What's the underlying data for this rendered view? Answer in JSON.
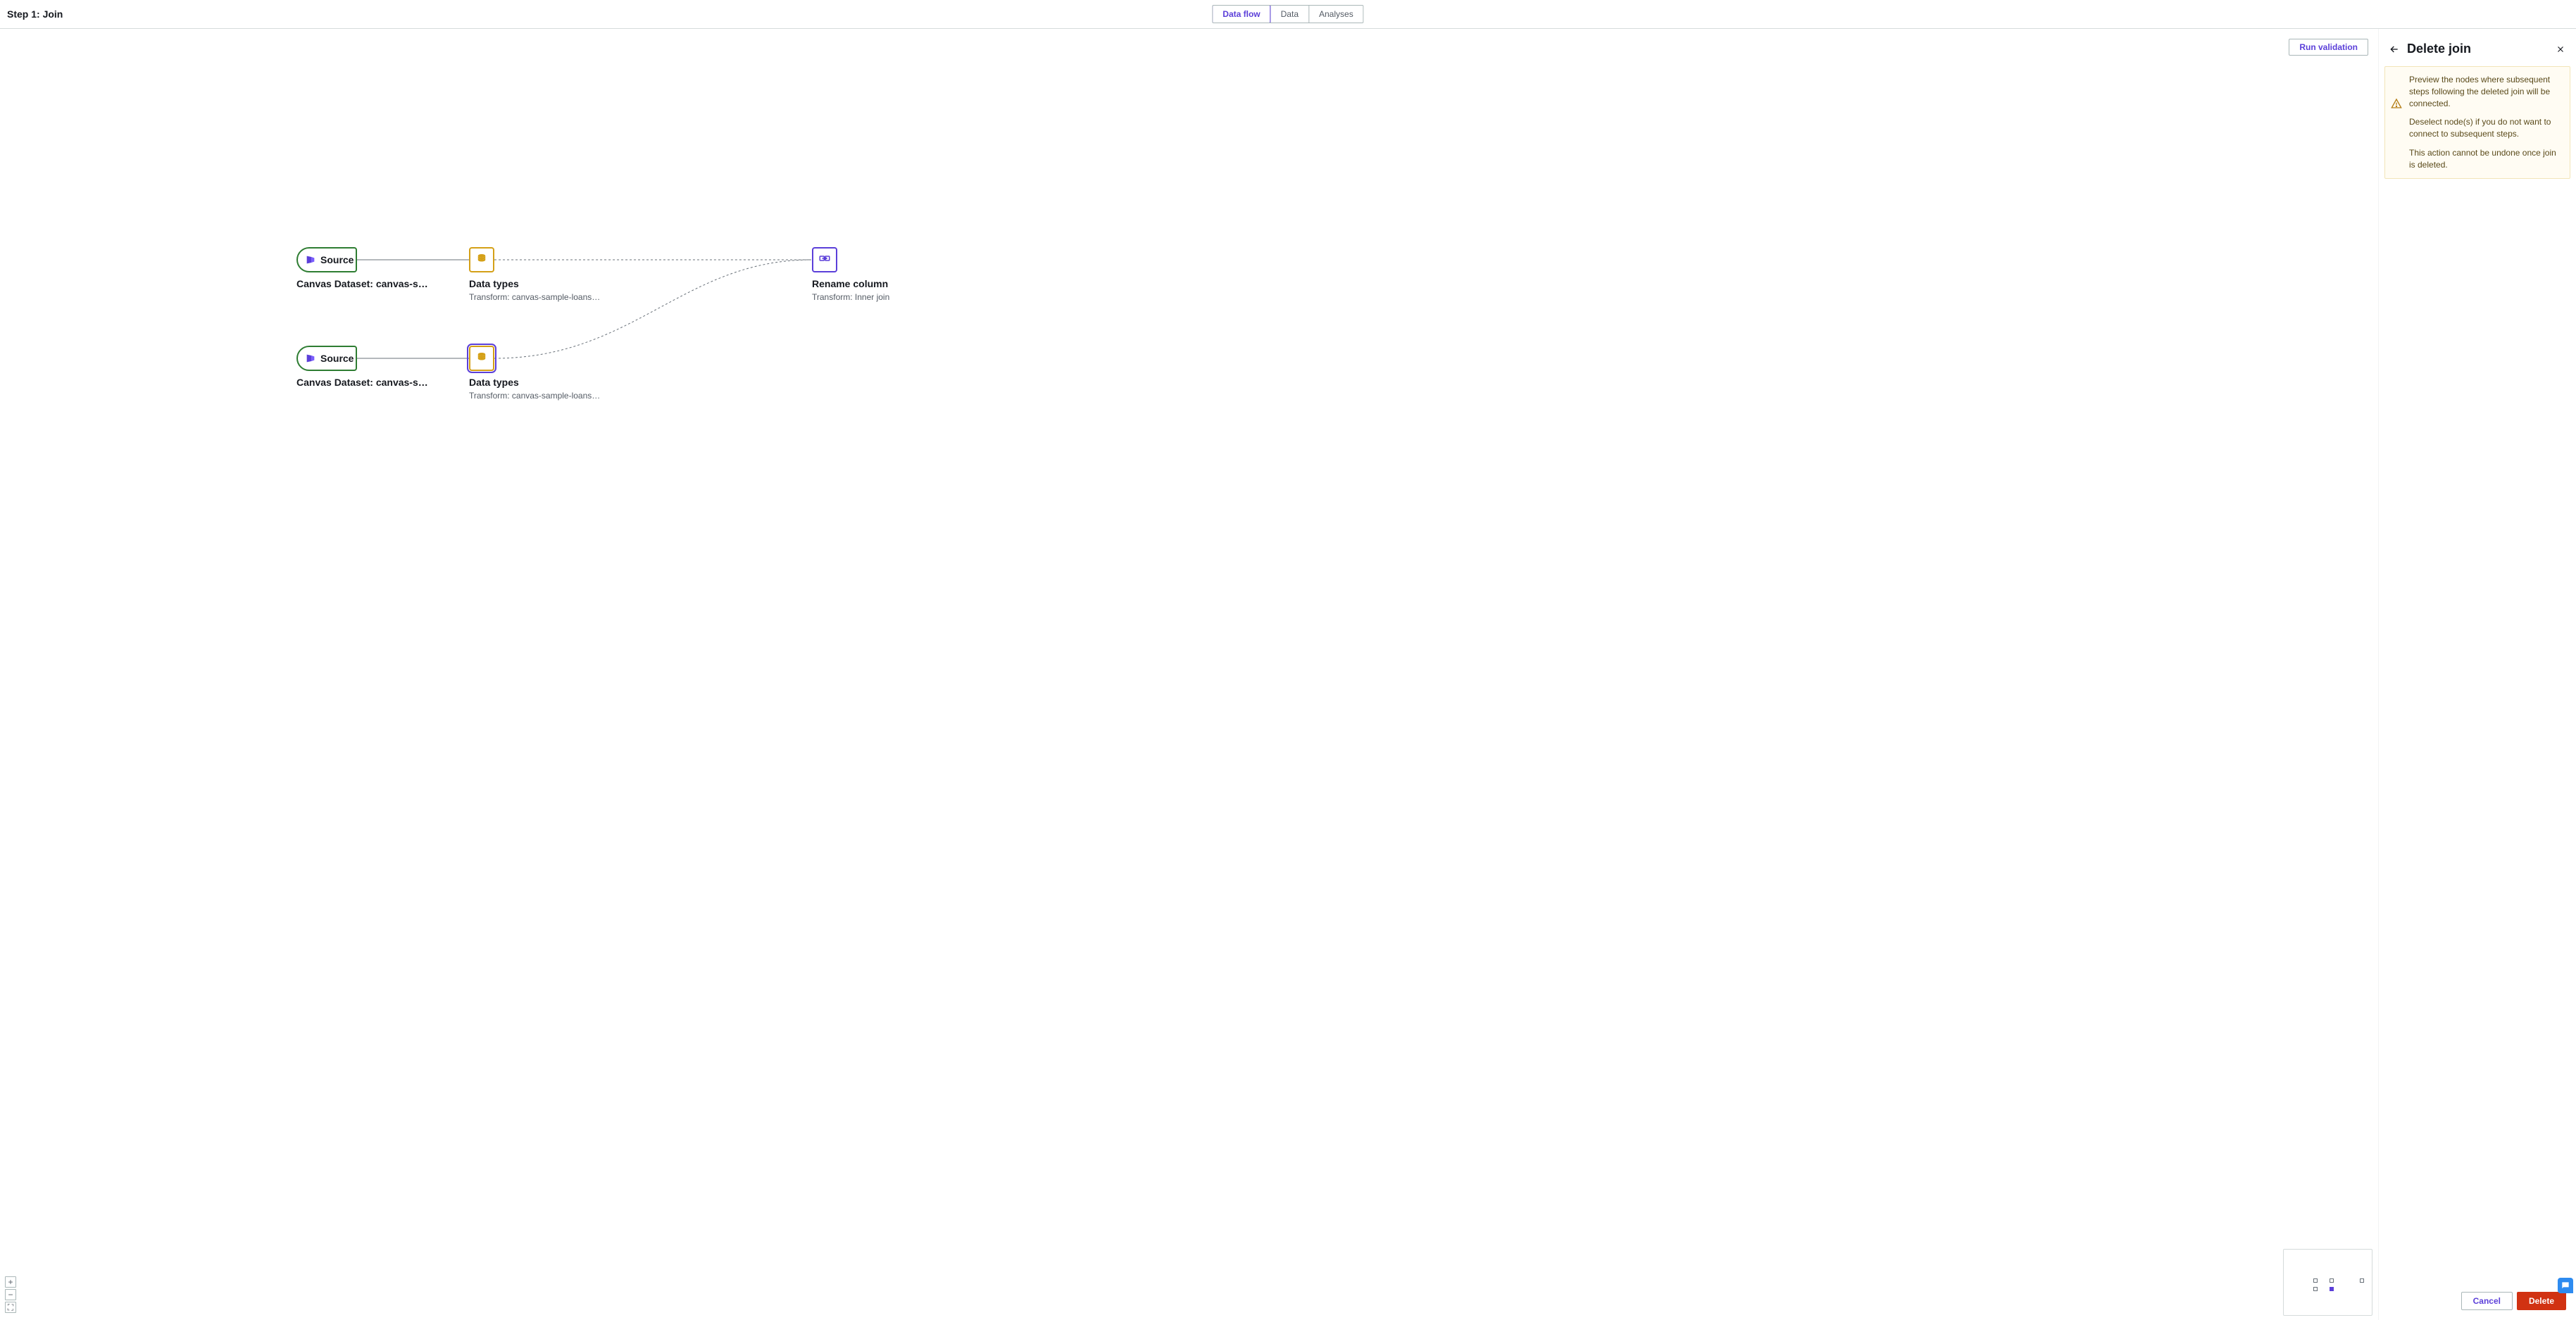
{
  "header": {
    "step_title": "Step 1: Join",
    "tabs": [
      "Data flow",
      "Data",
      "Analyses"
    ],
    "active_tab": 0
  },
  "run_validation_label": "Run validation",
  "flow": {
    "nodes": {
      "source1": {
        "type": "source",
        "title": "Source",
        "label": "Canvas Dataset: canvas-sample-…"
      },
      "source2": {
        "type": "source",
        "title": "Source",
        "label": "Canvas Dataset: canvas-sample-…"
      },
      "dtypes1": {
        "type": "datatypes",
        "label": "Data types",
        "sublabel": "Transform: canvas-sample-loans-part-…"
      },
      "dtypes2": {
        "type": "datatypes",
        "selected": true,
        "label": "Data types",
        "sublabel": "Transform: canvas-sample-loans-part-…"
      },
      "rename": {
        "type": "rename",
        "label": "Rename column",
        "sublabel": "Transform: Inner join"
      }
    }
  },
  "panel": {
    "title": "Delete join",
    "warn_lines": [
      "Preview the nodes where subsequent steps following the deleted join will be connected.",
      "Deselect node(s) if you do not want to connect to subsequent steps.",
      "This action cannot be undone once join is deleted."
    ],
    "cancel": "Cancel",
    "delete": "Delete"
  },
  "icons": {
    "back": "←",
    "close": "✕",
    "plus": "+",
    "minus": "−",
    "fullscreen": "⛶"
  }
}
